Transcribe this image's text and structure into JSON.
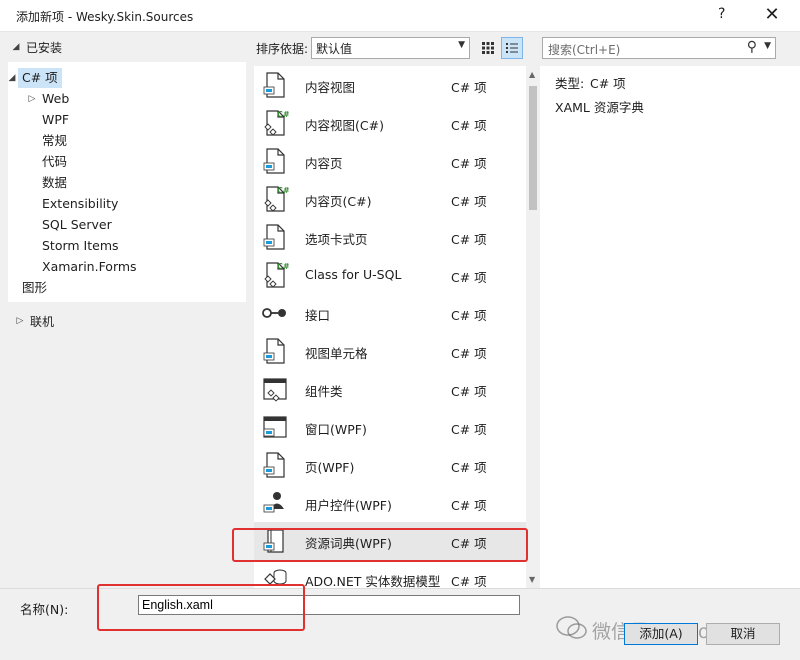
{
  "window": {
    "title": "添加新项 - Wesky.Skin.Sources",
    "help": "?",
    "close": "✕"
  },
  "sidebar": {
    "installed_label": "已安装",
    "tree": [
      {
        "label": "C# 项",
        "level": 0,
        "expanded": true,
        "selected": true
      },
      {
        "label": "Web",
        "level": 1,
        "collapsed": true
      },
      {
        "label": "WPF",
        "level": 1
      },
      {
        "label": "常规",
        "level": 1
      },
      {
        "label": "代码",
        "level": 1
      },
      {
        "label": "数据",
        "level": 1
      },
      {
        "label": "Extensibility",
        "level": 1
      },
      {
        "label": "SQL Server",
        "level": 1
      },
      {
        "label": "Storm Items",
        "level": 1
      },
      {
        "label": "Xamarin.Forms",
        "level": 1
      },
      {
        "label": "图形",
        "level": 0
      }
    ],
    "online_label": "联机"
  },
  "sort": {
    "label": "排序依据:",
    "value": "默认值"
  },
  "search": {
    "placeholder": "搜索(Ctrl+E)"
  },
  "templates": [
    {
      "name": "内容视图",
      "type": "C# 项",
      "icon": "xaml-file-icon"
    },
    {
      "name": "内容视图(C#)",
      "type": "C# 项",
      "icon": "csharp-file-icon"
    },
    {
      "name": "内容页",
      "type": "C# 项",
      "icon": "xaml-file-icon"
    },
    {
      "name": "内容页(C#)",
      "type": "C# 项",
      "icon": "csharp-file-icon"
    },
    {
      "name": "选项卡式页",
      "type": "C# 项",
      "icon": "xaml-file-icon"
    },
    {
      "name": "Class for U-SQL",
      "type": "C# 项",
      "icon": "csharp-file-icon"
    },
    {
      "name": "接口",
      "type": "C# 项",
      "icon": "interface-icon"
    },
    {
      "name": "视图单元格",
      "type": "C# 项",
      "icon": "xaml-file-icon"
    },
    {
      "name": "组件类",
      "type": "C# 项",
      "icon": "component-class-icon"
    },
    {
      "name": "窗口(WPF)",
      "type": "C# 项",
      "icon": "window-icon"
    },
    {
      "name": "页(WPF)",
      "type": "C# 项",
      "icon": "xaml-file-icon"
    },
    {
      "name": "用户控件(WPF)",
      "type": "C# 项",
      "icon": "user-control-icon"
    },
    {
      "name": "资源词典(WPF)",
      "type": "C# 项",
      "icon": "resource-dictionary-icon",
      "selected": true
    },
    {
      "name": "ADO.NET 实体数据模型",
      "type": "C# 项",
      "icon": "entity-model-icon"
    }
  ],
  "details": {
    "type_label": "类型:",
    "type_value": "C# 项",
    "description": "XAML 资源字典"
  },
  "name_field": {
    "label": "名称(N):",
    "value": "English.xaml"
  },
  "buttons": {
    "add": "添加(A)",
    "cancel": "取消"
  },
  "watermark": "微信号: art_of_code",
  "colors": {
    "selection": "#cce4f7",
    "highlight_box": "#e03030",
    "primary_border": "#0078d7"
  }
}
